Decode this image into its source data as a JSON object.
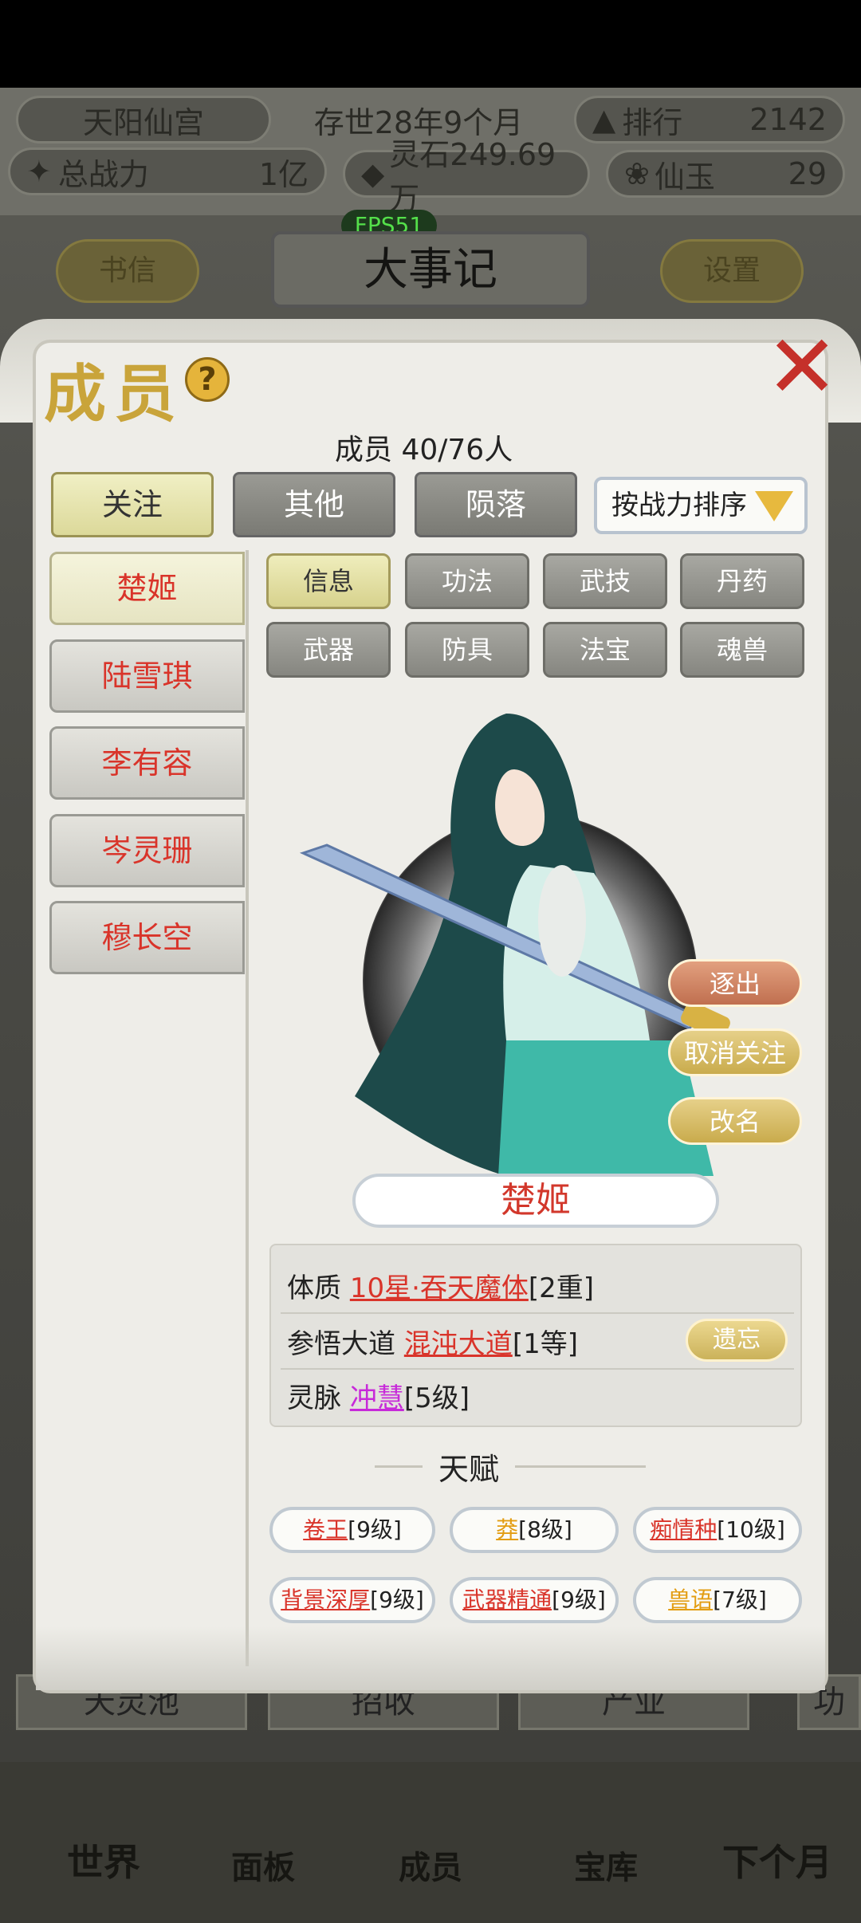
{
  "header": {
    "sect_name": "天阳仙宫",
    "era": "存世28年9个月",
    "rank_label": "排行",
    "rank_value": "2142",
    "power_label": "总战力",
    "power_value": "1亿",
    "spirit_stone": "灵石249.69万",
    "jade_label": "仙玉",
    "jade_value": "29",
    "fps": "FPS51"
  },
  "background": {
    "letters_button": "书信",
    "events_title": "大事记",
    "settings_button": "设置",
    "row": [
      "天灵池",
      "招收",
      "产业",
      "功"
    ],
    "nav": [
      "世界",
      "面板",
      "成员",
      "宝库",
      "下个月"
    ]
  },
  "modal": {
    "title": "成员",
    "help": "?",
    "close": "✕",
    "count": "成员 40/76人",
    "tabs": [
      "关注",
      "其他",
      "陨落"
    ],
    "sort_label": "按战力排序",
    "members": [
      "楚姬",
      "陆雪琪",
      "李有容",
      "岑灵珊",
      "穆长空"
    ],
    "subtabs": [
      "信息",
      "功法",
      "武技",
      "丹药",
      "武器",
      "防具",
      "法宝",
      "魂兽"
    ],
    "actions": {
      "expel": "逐出",
      "unfollow": "取消关注",
      "rename": "改名"
    },
    "name": "楚姬",
    "info": {
      "constitution_label": "体质",
      "constitution_value": "10星·吞天魔体",
      "constitution_level": "[2重]",
      "dao_label": "参悟大道",
      "dao_value": "混沌大道",
      "dao_level": "[1等]",
      "forget_button": "遗忘",
      "vein_label": "灵脉",
      "vein_value": "冲慧",
      "vein_level": "[5级]"
    },
    "talent_heading": "天赋",
    "talents": [
      {
        "name": "卷王",
        "level": "[9级]",
        "color": "red"
      },
      {
        "name": "莽",
        "level": "[8级]",
        "color": "orange"
      },
      {
        "name": "痴情种",
        "level": "[10级]",
        "color": "red"
      },
      {
        "name": "背景深厚",
        "level": "[9级]",
        "color": "red"
      },
      {
        "name": "武器精通",
        "level": "[9级]",
        "color": "red"
      },
      {
        "name": "兽语",
        "level": "[7级]",
        "color": "orange"
      }
    ]
  }
}
